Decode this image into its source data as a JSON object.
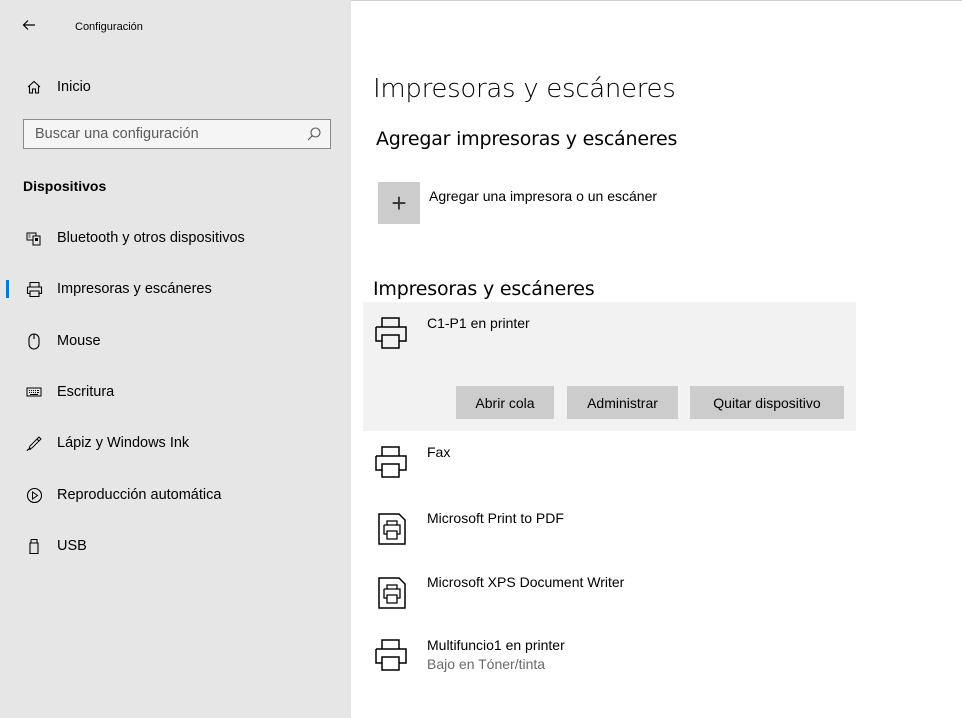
{
  "window": {
    "title": "Configuración"
  },
  "sidebar": {
    "home": {
      "label": "Inicio",
      "icon": "home-icon"
    },
    "search": {
      "placeholder": "Buscar una configuración",
      "icon": "search-icon"
    },
    "section": "Dispositivos",
    "items": [
      {
        "label": "Bluetooth y otros dispositivos",
        "icon": "bluetooth-devices-icon",
        "active": false
      },
      {
        "label": "Impresoras y escáneres",
        "icon": "printer-icon",
        "active": true
      },
      {
        "label": "Mouse",
        "icon": "mouse-icon",
        "active": false
      },
      {
        "label": "Escritura",
        "icon": "keyboard-icon",
        "active": false
      },
      {
        "label": "Lápiz y Windows Ink",
        "icon": "pen-icon",
        "active": false
      },
      {
        "label": "Reproducción automática",
        "icon": "autoplay-icon",
        "active": false
      },
      {
        "label": "USB",
        "icon": "usb-icon",
        "active": false
      }
    ]
  },
  "main": {
    "title": "Impresoras y escáneres",
    "add_section": {
      "title": "Agregar impresoras y escáneres",
      "add_label": "Agregar una impresora o un escáner",
      "add_symbol": "+"
    },
    "list_title": "Impresoras y escáneres",
    "devices": [
      {
        "name": "C1-P1 en printer",
        "status": "",
        "icon": "printer-icon",
        "selected": true
      },
      {
        "name": "Fax",
        "status": "",
        "icon": "printer-icon",
        "selected": false
      },
      {
        "name": "Microsoft Print to PDF",
        "status": "",
        "icon": "document-printer-icon",
        "selected": false
      },
      {
        "name": "Microsoft XPS Document Writer",
        "status": "",
        "icon": "document-printer-icon",
        "selected": false
      },
      {
        "name": "Multifuncio1 en printer",
        "status": "Bajo en Tóner/tinta",
        "icon": "printer-icon",
        "selected": false
      }
    ],
    "actions": {
      "open_queue": "Abrir cola",
      "manage": "Administrar",
      "remove": "Quitar dispositivo"
    }
  },
  "colors": {
    "accent": "#0078d7",
    "sidebar_bg": "#e6e6e6",
    "selected_bg": "#f2f2f2",
    "button_bg": "#cccccc"
  }
}
